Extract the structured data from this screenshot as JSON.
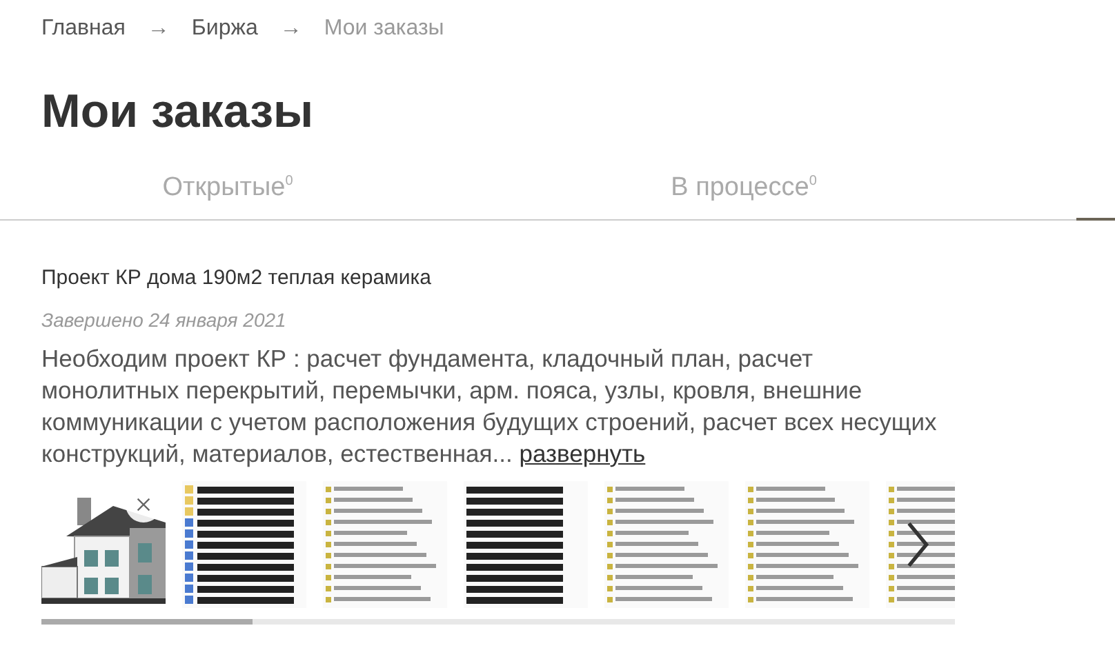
{
  "breadcrumbs": [
    {
      "label": "Главная",
      "current": false
    },
    {
      "label": "Биржа",
      "current": false
    },
    {
      "label": "Мои заказы",
      "current": true
    }
  ],
  "breadcrumb_separator": "→",
  "page_title": "Мои заказы",
  "tabs": [
    {
      "label": "Открытые",
      "count": "0"
    },
    {
      "label": "В процессе",
      "count": "0"
    }
  ],
  "order": {
    "title": "Проект КР дома 190м2 теплая керамика",
    "status": "Завершено 24 января 2021",
    "description": "Необходим проект КР : расчет фундамента, кладочный план, расчет монолитных перекрытий, перемычки, арм. пояса, узлы, кровля, внешние коммуникации с учетом расположения будущих строений, расчет всех несущих конструкций, материалов, естественная...",
    "more_link": "развернуть",
    "thumbnails": [
      {
        "kind": "house"
      },
      {
        "kind": "folders"
      },
      {
        "kind": "list"
      },
      {
        "kind": "bold-list"
      },
      {
        "kind": "list"
      },
      {
        "kind": "list"
      },
      {
        "kind": "list"
      }
    ]
  }
}
